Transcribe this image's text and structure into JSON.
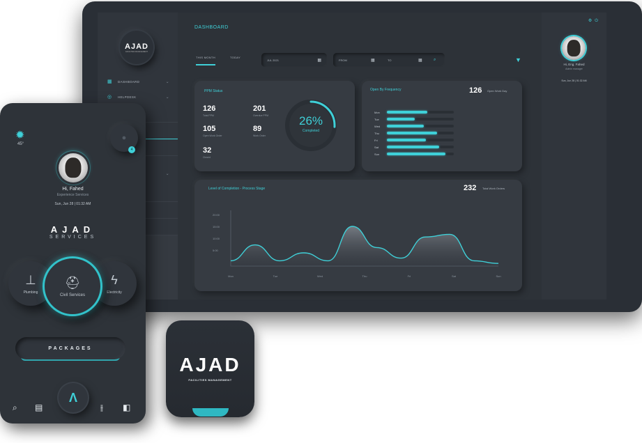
{
  "desktop": {
    "logo": {
      "text": "AJAD",
      "sub": "FACILITIES MANAGEMENT"
    },
    "nav": [
      {
        "icon": "grid-icon",
        "label": "DASHBOARD"
      },
      {
        "icon": "headset-icon",
        "label": "HELPDESK"
      }
    ],
    "title": "DASHBOARD",
    "tabs": [
      "THIS MONTH",
      "TODAY"
    ],
    "date_select": "JUL 2021",
    "from_label": "FROM",
    "to_label": "TO",
    "ppm": {
      "title": "PPM Status",
      "stats": [
        {
          "n": "126",
          "l": "Total PPM"
        },
        {
          "n": "201",
          "l": "Overdue PPM"
        },
        {
          "n": "105",
          "l": "Open Work Order"
        },
        {
          "n": "89",
          "l": "Work Order"
        },
        {
          "n": "32",
          "l": "Closed"
        }
      ],
      "percent": "26%",
      "percent_value": 0.26,
      "percent_label": "Completed"
    },
    "frequency": {
      "title": "Open By Frequency",
      "total": "126",
      "total_label": "Open Work Day",
      "rows": [
        {
          "day": "Mon",
          "value": 0.6
        },
        {
          "day": "Tue",
          "value": 0.42
        },
        {
          "day": "Wed",
          "value": 0.55
        },
        {
          "day": "Thu",
          "value": 0.75
        },
        {
          "day": "Fri",
          "value": 0.58
        },
        {
          "day": "Sat",
          "value": 0.78
        },
        {
          "day": "Sun",
          "value": 0.88
        }
      ]
    },
    "chart_card": {
      "title": "Level of Completion - Process Stage",
      "total": "232",
      "total_label": "Total Work Orders"
    },
    "profile": {
      "name": "Hi, Eng. Fahed",
      "role": "Admin manager",
      "date": "Sun, Jun 28 | 01:32 AM"
    }
  },
  "chart_data": {
    "type": "area",
    "title": "Level of Completion - Process Stage",
    "x": [
      "Mon",
      "Tue",
      "Wed",
      "Thu",
      "Fri",
      "Sat",
      "Sun"
    ],
    "yticks": [
      "20:00",
      "15:00",
      "10:00",
      "5:00"
    ],
    "ylim": [
      0,
      20
    ],
    "series": [
      {
        "values": [
          2,
          8,
          2,
          5,
          2,
          15,
          7,
          3,
          11,
          12,
          2,
          1
        ]
      }
    ]
  },
  "phone": {
    "temp": "45°",
    "badge": "4",
    "greeting": "Hi, Fahed",
    "sub": "Experience Services",
    "date": "Sun, Jun 28 | 01:32 AM",
    "brand": "AJAD",
    "brand_sub": "SERVICES",
    "services": {
      "left": "Plumbing",
      "center": "Civil Services",
      "right": "Electricity"
    },
    "packages": "PACKAGES"
  },
  "tile": {
    "text": "AJAD",
    "sub": "FACILITIES MANAGEMENT"
  }
}
